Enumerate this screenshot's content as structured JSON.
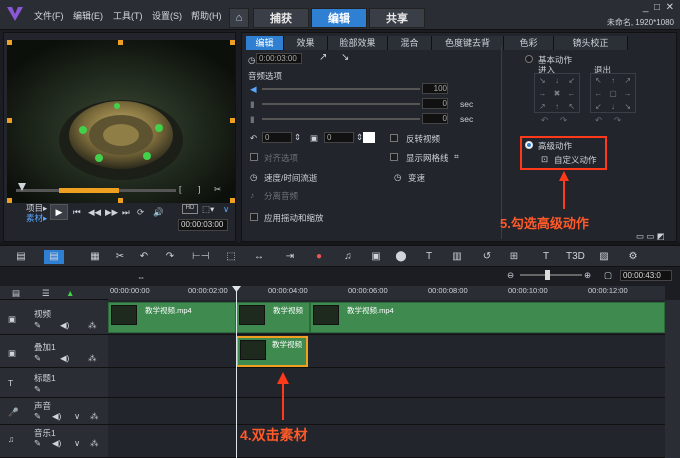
{
  "menu": [
    "文件(F)",
    "编辑(E)",
    "工具(T)",
    "设置(S)",
    "帮助(H)"
  ],
  "main_tabs": [
    {
      "label": "捕获"
    },
    {
      "label": "编辑"
    },
    {
      "label": "共享"
    }
  ],
  "project_info": "未命名, 1920*1080",
  "preview": {
    "clip_label": "项目▸",
    "source_label": "素材▸",
    "timecode": "00:00:03:00",
    "zoom_label": "HD"
  },
  "edit_tabs": [
    "编辑",
    "效果",
    "脸部效果",
    "混合",
    "色度键去背",
    "色彩",
    "镜头校正"
  ],
  "edit_panel": {
    "duration": "0:00:03:00",
    "audio_options": "音频选项",
    "vol1": "100",
    "vol2": "0",
    "vol3": "0",
    "sec": "sec",
    "spin1": "0",
    "spin2": "0",
    "reverse_video": "反转视频",
    "show_grid": "显示网格线",
    "align_options": "对齐选项",
    "speed_time": "速度/时间流逝",
    "split_audio": "分离音频",
    "variable_speed": "变速",
    "pan_zoom": "应用摇动和缩放",
    "basic_motion": "基本动作",
    "enter": "进入",
    "exit": "退出",
    "advanced_motion": "高级动作",
    "custom_motion": "自定义动作"
  },
  "annotations": {
    "step5": "5.勾选高级动作",
    "step4": "4.双击素材"
  },
  "timeline": {
    "timecode": "00:00:43:0",
    "ruler": [
      "00:00:00:00",
      "00:00:02:00",
      "00:00:04:00",
      "00:00:06:00",
      "00:00:08:00",
      "00:00:10:00",
      "00:00:12:00"
    ],
    "tracks": [
      {
        "name": "视频"
      },
      {
        "name": "叠加1"
      },
      {
        "name": "标题1"
      },
      {
        "name": "声音"
      },
      {
        "name": "音乐1"
      }
    ],
    "clips": {
      "video1": "教学视频.mp4",
      "video2": "教学视频",
      "video3": "教学视频.mp4",
      "overlay": "教学视频"
    }
  },
  "colors": {
    "accent": "#2f7fd3",
    "clip": "#3f8a4f",
    "annotation": "#ff3a1a",
    "handle": "#f0a020"
  }
}
